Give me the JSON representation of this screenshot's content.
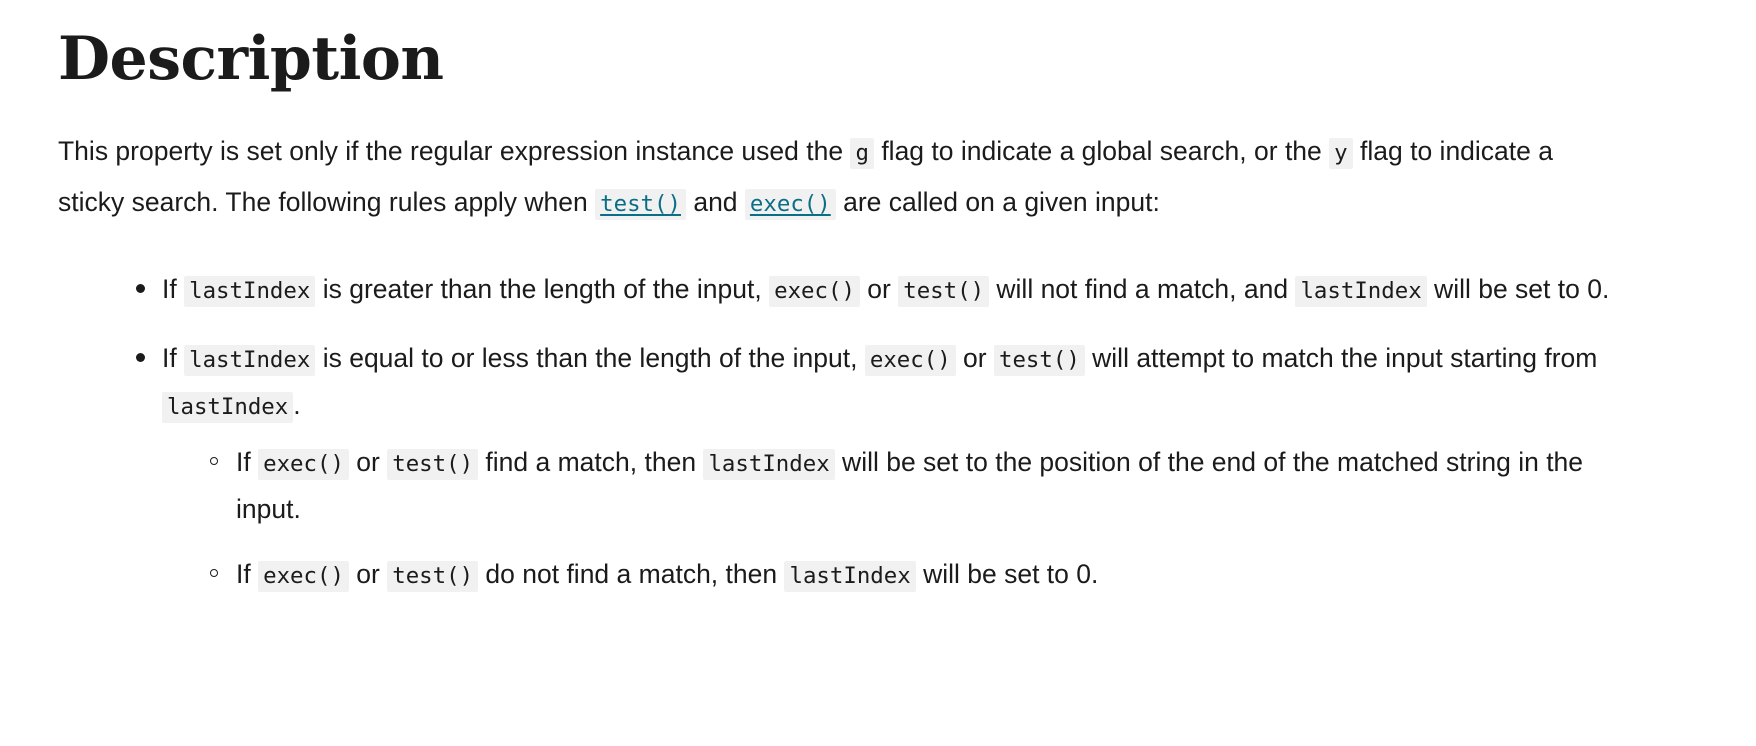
{
  "heading": "Description",
  "intro": {
    "part1": "This property is set only if the regular expression instance used the ",
    "code_g": "g",
    "part2": " flag to indicate a global search, or the ",
    "code_y": "y",
    "part3": " flag to indicate a sticky search. The following rules apply when ",
    "link_test": "test()",
    "part4": " and ",
    "link_exec": "exec()",
    "part5": " are called on a given input:"
  },
  "bullets": [
    {
      "seg1": "If ",
      "code1": "lastIndex",
      "seg2": " is greater than the length of the input, ",
      "code2": "exec()",
      "seg3": " or ",
      "code3": "test()",
      "seg4": " will not find a match, and ",
      "code4": "lastIndex",
      "seg5": " will be set to 0."
    },
    {
      "seg1": "If ",
      "code1": "lastIndex",
      "seg2": " is equal to or less than the length of the input, ",
      "code2": "exec()",
      "seg3": " or ",
      "code3": "test()",
      "seg4": " will attempt to match the input starting from ",
      "code4": "lastIndex",
      "seg5": ".",
      "subbullets": [
        {
          "seg1": "If ",
          "code1": "exec()",
          "seg2": " or ",
          "code2": "test()",
          "seg3": " find a match, then ",
          "code3": "lastIndex",
          "seg4": " will be set to the position of the end of the matched string in the input."
        },
        {
          "seg1": "If ",
          "code1": "exec()",
          "seg2": " or ",
          "code2": "test()",
          "seg3": " do not find a match, then ",
          "code3": "lastIndex",
          "seg4": " will be set to 0."
        }
      ]
    }
  ],
  "colors": {
    "text": "#1b1b1b",
    "link": "#0b6e87",
    "code_bg": "#f2f1f1",
    "page_bg": "#ffffff"
  }
}
